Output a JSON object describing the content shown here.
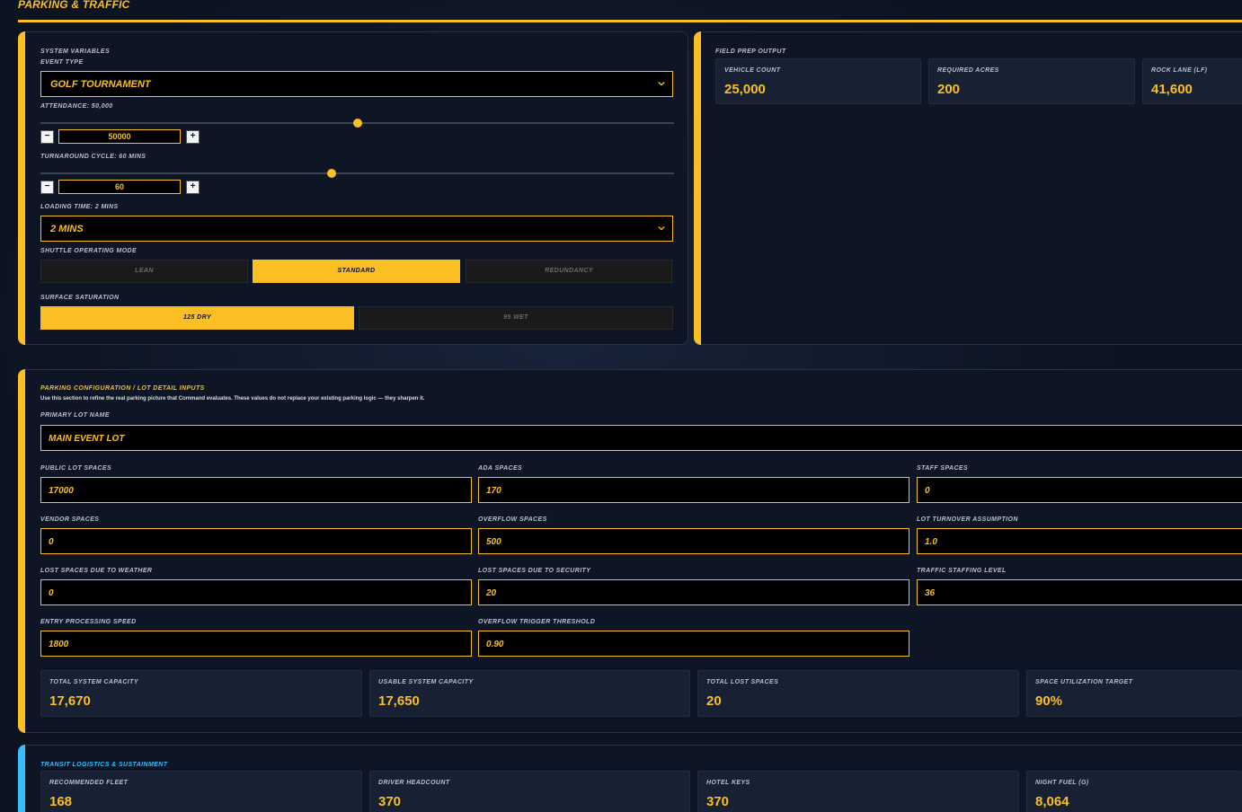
{
  "header": {
    "title": "PARKING & TRAFFIC"
  },
  "system": {
    "section_title": "SYSTEM VARIABLES",
    "event_type_label": "EVENT TYPE",
    "event_type_value": "GOLF TOURNAMENT",
    "attendance_label": "ATTENDANCE: 50,000",
    "attendance_value": "50000",
    "attendance_fraction": 0.5,
    "turnaround_label": "TURNAROUND CYCLE: 60 MINS",
    "turnaround_value": "60",
    "turnaround_fraction": 0.46,
    "loading_label": "LOADING TIME: 2 MINS",
    "loading_value": "2 MINS",
    "shuttle_mode_label": "SHUTTLE OPERATING MODE",
    "shuttle_modes": [
      "LEAN",
      "STANDARD",
      "REDUNDANCY"
    ],
    "shuttle_mode_selected": "STANDARD",
    "surface_label": "SURFACE SATURATION",
    "surface_options": [
      "125 DRY",
      "95 WET"
    ],
    "surface_selected": "125 DRY",
    "minus": "−",
    "plus": "+"
  },
  "field_prep": {
    "section_title": "FIELD PREP OUTPUT",
    "cards": [
      {
        "label": "VEHICLE COUNT",
        "value": "25,000"
      },
      {
        "label": "REQUIRED ACRES",
        "value": "200"
      },
      {
        "label": "ROCK LANE (LF)",
        "value": "41,600"
      }
    ]
  },
  "parking": {
    "section_title": "PARKING CONFIGURATION / LOT DETAIL INPUTS",
    "note": "Use this section to refine the real parking picture that Command evaluates. These values do not replace your existing parking logic — they sharpen it.",
    "primary_lot_label": "PRIMARY LOT NAME",
    "primary_lot_value": "MAIN EVENT LOT",
    "fields": [
      {
        "label": "PUBLIC LOT SPACES",
        "value": "17000"
      },
      {
        "label": "ADA SPACES",
        "value": "170"
      },
      {
        "label": "STAFF SPACES",
        "value": "0"
      },
      {
        "label": "VENDOR SPACES",
        "value": "0"
      },
      {
        "label": "OVERFLOW SPACES",
        "value": "500"
      },
      {
        "label": "LOT TURNOVER ASSUMPTION",
        "value": "1.0"
      },
      {
        "label": "LOST SPACES DUE TO WEATHER",
        "value": "0"
      },
      {
        "label": "LOST SPACES DUE TO SECURITY",
        "value": "20"
      },
      {
        "label": "TRAFFIC STAFFING LEVEL",
        "value": "36"
      },
      {
        "label": "ENTRY PROCESSING SPEED",
        "value": "1800"
      },
      {
        "label": "OVERFLOW TRIGGER THRESHOLD",
        "value": "0.90"
      }
    ],
    "summary": [
      {
        "label": "TOTAL SYSTEM CAPACITY",
        "value": "17,670"
      },
      {
        "label": "USABLE SYSTEM CAPACITY",
        "value": "17,650"
      },
      {
        "label": "TOTAL LOST SPACES",
        "value": "20"
      },
      {
        "label": "SPACE UTILIZATION TARGET",
        "value": "90%"
      }
    ]
  },
  "transit": {
    "section_title": "TRANSIT LOGISTICS & SUSTAINMENT",
    "cards": [
      {
        "label": "RECOMMENDED FLEET",
        "value": "168"
      },
      {
        "label": "DRIVER HEADCOUNT",
        "value": "370"
      },
      {
        "label": "HOTEL KEYS",
        "value": "370"
      },
      {
        "label": "NIGHT FUEL (G)",
        "value": "8,064"
      }
    ]
  },
  "colors": {
    "accent": "#fbbf24",
    "transit_accent": "#38bdf8",
    "background": "#0c1321"
  },
  "icons": {
    "select_chevron": "chevron-down-icon"
  }
}
